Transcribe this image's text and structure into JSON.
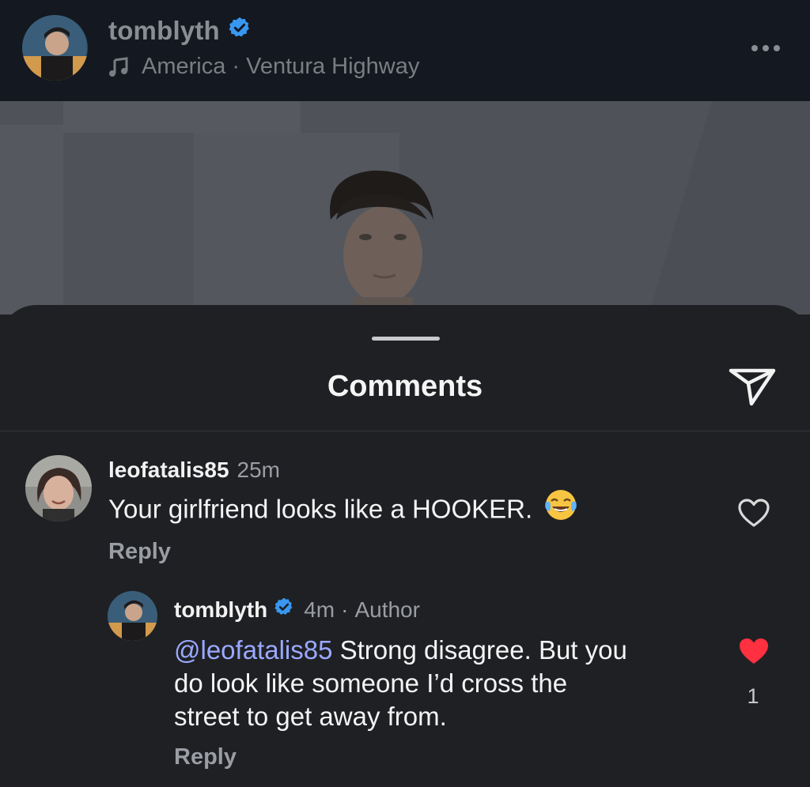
{
  "header": {
    "username": "tomblyth",
    "music": "America · Ventura Highway"
  },
  "sheet": {
    "title": "Comments"
  },
  "comments": [
    {
      "username": "leofatalis85",
      "time": "25m",
      "text": "Your girlfriend looks like a HOOKER.",
      "emoji": "tears-of-joy-emoji",
      "reply_label": "Reply",
      "liked": false
    },
    {
      "username": "tomblyth",
      "time": "4m",
      "tag": "Author",
      "mention": "@leofatalis85",
      "text_lines": [
        "Strong disagree. But you",
        "do look like someone I’d cross the",
        "street to get away from."
      ],
      "reply_label": "Reply",
      "liked": true,
      "like_count": "1"
    }
  ],
  "colors": {
    "verified_blue": "#3897f0",
    "liked_red": "#ff3040",
    "mention_blue": "#9aa9ff"
  }
}
